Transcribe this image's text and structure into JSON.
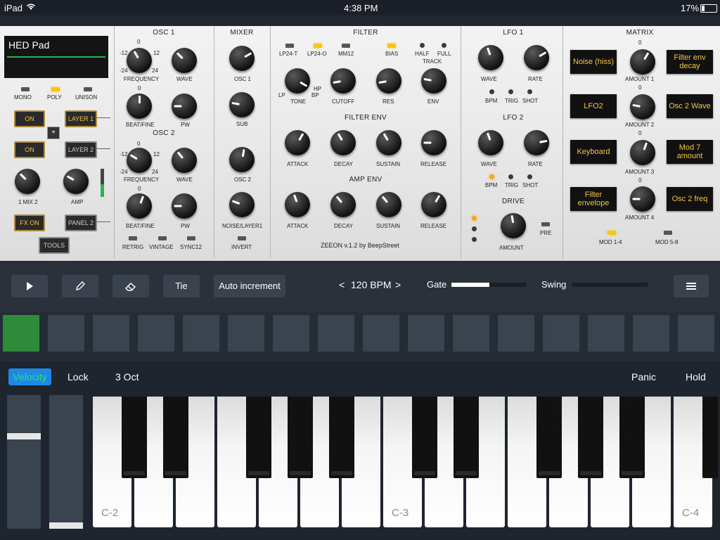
{
  "status": {
    "device": "iPad",
    "time": "4:38 PM",
    "battery": "17%"
  },
  "patch": {
    "name": "HED Pad"
  },
  "voice": {
    "mono": "MONO",
    "poly": "POLY",
    "unison": "UNISON"
  },
  "layer_buttons": {
    "on1": "ON",
    "layer1": "LAYER 1",
    "plus": "+",
    "on2": "ON",
    "layer2": "LAYER 2",
    "fx": "FX ON",
    "panel2": "PANEL 2",
    "tools": "TOOLS"
  },
  "left_knobs": {
    "mix": "1 MIX 2",
    "amp": "AMP"
  },
  "osc1": {
    "title": "OSC 1",
    "frequency": "FREQUENCY",
    "wave": "WAVE",
    "beatfine": "BEAT/FINE",
    "pw": "PW",
    "n0": "0",
    "nm12": "-12",
    "n12": "12",
    "nm24": "-24",
    "n24": "24",
    "bf0": "0"
  },
  "osc2": {
    "title": "OSC 2",
    "frequency": "FREQUENCY",
    "wave": "WAVE",
    "beatfine": "BEAT/FINE",
    "pw": "PW",
    "n0": "0",
    "nm12": "-12",
    "n12": "12",
    "nm24": "-24",
    "n24": "24",
    "bf0": "0",
    "retrig": "RETRIG",
    "vintage": "VINTAGE",
    "sync": "SYNC12"
  },
  "mixer": {
    "title": "MIXER",
    "osc1": "OSC 1",
    "sub": "SUB",
    "osc2": "OSC 2",
    "noise": "NOISE/LAYER1",
    "invert": "INVERT"
  },
  "filter": {
    "title": "FILTER",
    "lp24t": "LP24-T",
    "lp24o": "LP24-O",
    "mm12": "MM12",
    "bias": "BIAS",
    "half": "HALF",
    "full": "FULL",
    "track": "TRACK",
    "tone": "TONE",
    "lp": "LP",
    "hp": "HP",
    "bp": "BP",
    "cutoff": "CUTOFF",
    "res": "RES",
    "env": "ENV"
  },
  "filter_env": {
    "title": "FILTER ENV",
    "attack": "ATTACK",
    "decay": "DECAY",
    "sustain": "SUSTAIN",
    "release": "RELEASE"
  },
  "amp_env": {
    "title": "AMP ENV",
    "attack": "ATTACK",
    "decay": "DECAY",
    "sustain": "SUSTAIN",
    "release": "RELEASE"
  },
  "version": "ZEEON v.1.2 by BeepStreet",
  "lfo1": {
    "title": "LFO 1",
    "wave": "WAVE",
    "rate": "RATE",
    "bpm": "BPM",
    "trig": "TRIG",
    "shot": "SHOT"
  },
  "lfo2": {
    "title": "LFO 2",
    "wave": "WAVE",
    "rate": "RATE",
    "bpm": "BPM",
    "trig": "TRIG",
    "shot": "SHOT"
  },
  "drive": {
    "title": "DRIVE",
    "amount": "AMOUNT",
    "pre": "PRE"
  },
  "matrix": {
    "title": "MATRIX",
    "rows": [
      {
        "source": "Noise (hiss)",
        "amount": "AMOUNT 1",
        "zero": "0",
        "dest": "Filter env decay"
      },
      {
        "source": "LFO2",
        "amount": "AMOUNT 2",
        "zero": "0",
        "dest": "Osc 2 Wave"
      },
      {
        "source": "Keyboard",
        "amount": "AMOUNT 3",
        "zero": "0",
        "dest": "Mod 7 amount"
      },
      {
        "source": "Filter envelope",
        "amount": "AMOUNT 4",
        "zero": "0",
        "dest": "Osc 2 freq"
      }
    ],
    "mod14": "MOD 1-4",
    "mod58": "MOD 5-8"
  },
  "sequencer": {
    "play": "play-icon",
    "pencil": "pencil-icon",
    "eraser": "eraser-icon",
    "tie": "Tie",
    "auto": "Auto increment",
    "bpm_prev": "<",
    "bpm": "120 BPM",
    "bpm_next": ">",
    "gate_label": "Gate",
    "gate_value": 0.5,
    "swing_label": "Swing",
    "swing_value": 0.0,
    "menu": "menu-icon",
    "steps": 16,
    "active_step": 1
  },
  "keyboard": {
    "velocity": "Velocity",
    "lock": "Lock",
    "oct": "3 Oct",
    "panic": "Panic",
    "hold": "Hold",
    "c2": "C-2",
    "c3": "C-3",
    "c4": "C-4",
    "pitch_value": 0.3,
    "mod_value": 0.0
  },
  "colors": {
    "accent": "#2196f3",
    "led_on": "#f5c518",
    "step_active": "#2e8b3a",
    "matrix_text": "#f5c542"
  }
}
